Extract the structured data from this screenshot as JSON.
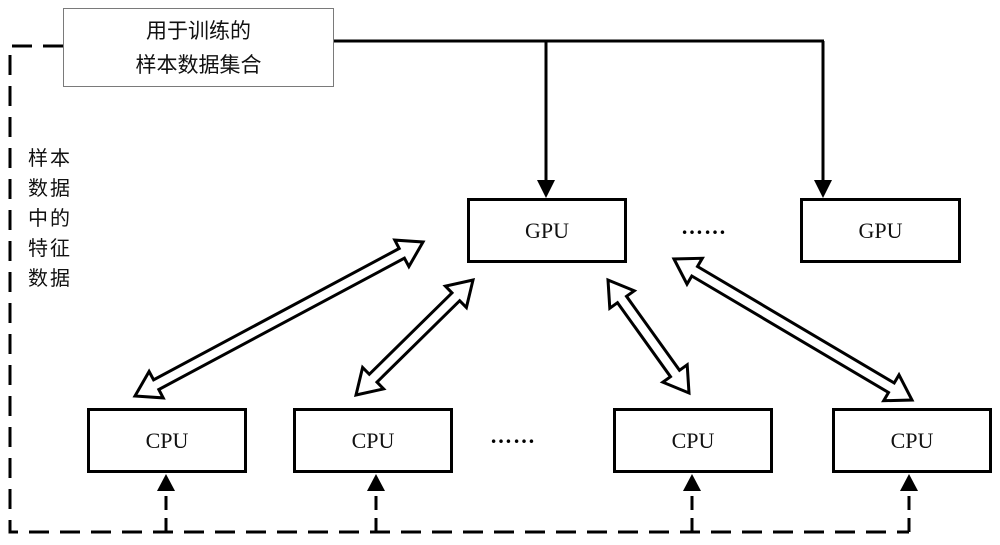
{
  "diagram": {
    "source_box": {
      "line1": "用于训练的",
      "line2": "样本数据集合"
    },
    "side_label": {
      "lines": [
        "样本",
        "数据",
        "中的",
        "特征",
        "数据"
      ]
    },
    "gpus": [
      {
        "label": "GPU"
      },
      {
        "label": "GPU"
      }
    ],
    "gpu_ellipsis": "……",
    "cpus": [
      {
        "label": "CPU"
      },
      {
        "label": "CPU"
      },
      {
        "label": "CPU"
      },
      {
        "label": "CPU"
      }
    ],
    "cpu_ellipsis": "……",
    "connections": {
      "solid": "sample data set → each GPU",
      "dashed": "feature data of samples → each CPU",
      "bidirectional": "CPU ↔ GPU"
    },
    "colors": {
      "line": "#000000",
      "source_border": "#7a7a7a",
      "background": "#ffffff"
    }
  }
}
